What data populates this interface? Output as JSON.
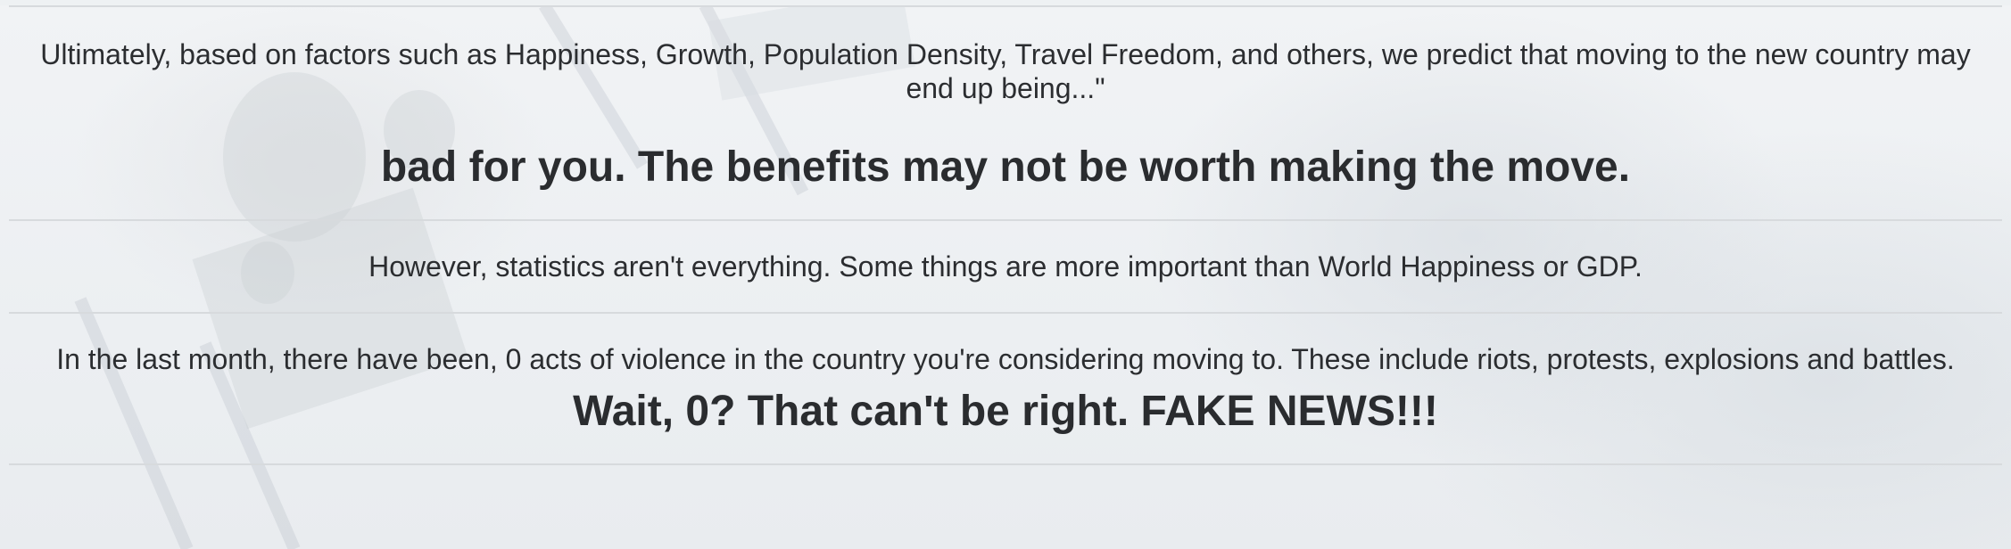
{
  "prediction": {
    "intro": "Ultimately, based on factors such as Happiness, Growth, Population Density, Travel Freedom, and others, we predict that moving to the new country may end up being...\"",
    "verdict": "bad for you. The benefits may not be worth making the move."
  },
  "caveat": {
    "text": "However, statistics aren't everything. Some things are more important than World Happiness or GDP."
  },
  "violence": {
    "text": "In the last month, there have been, 0 acts of violence in the country you're considering moving to. These include riots, protests, explosions and battles.",
    "reaction": "Wait, 0? That can't be right. FAKE NEWS!!!"
  }
}
